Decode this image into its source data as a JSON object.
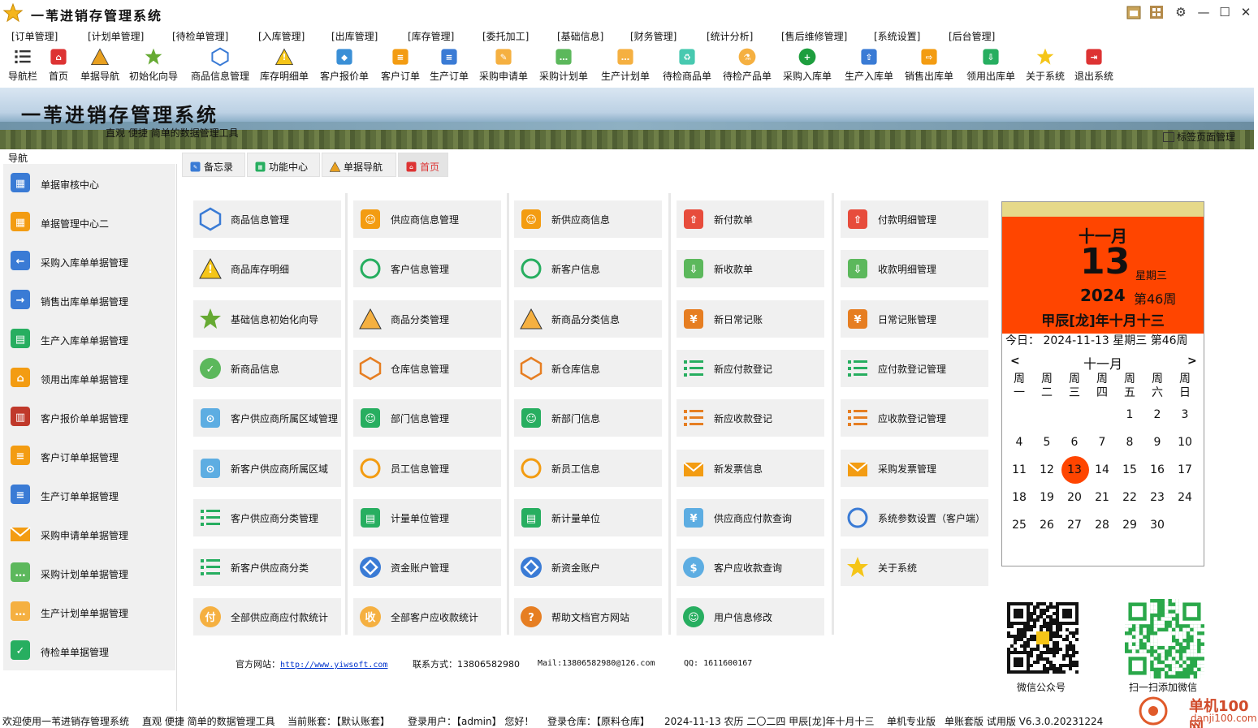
{
  "window": {
    "title": "一苇进销存管理系统"
  },
  "menu": [
    "[订单管理]",
    "[计划单管理]",
    "[待检单管理]",
    "[入库管理]",
    "[出库管理]",
    "[库存管理]",
    "[委托加工]",
    "[基础信息]",
    "[财务管理]",
    "[统计分析]",
    "[售后维修管理]",
    "[系统设置]",
    "[后台管理]"
  ],
  "toolbar": [
    "导航栏",
    "首页",
    "单据导航",
    "初始化向导",
    "商品信息管理",
    "库存明细单",
    "客户报价单",
    "客户订单",
    "生产订单",
    "采购申请单",
    "采购计划单",
    "生产计划单",
    "待检商品单",
    "待检产品单",
    "采购入库单",
    "生产入库单",
    "销售出库单",
    "领用出库单",
    "关于系统",
    "退出系统"
  ],
  "banner": {
    "title": "一苇进销存管理系统",
    "subtitle": "直观 便捷 简单的数据管理工具",
    "tag_manage": "标签页面管理"
  },
  "nav": {
    "label": "导航",
    "items": [
      "单据审核中心",
      "单据管理中心二",
      "采购入库单单据管理",
      "销售出库单单据管理",
      "生产入库单单据管理",
      "领用出库单单据管理",
      "客户报价单单据管理",
      "客户订单单据管理",
      "生产订单单据管理",
      "采购申请单单据管理",
      "采购计划单单据管理",
      "生产计划单单据管理",
      "待检单单据管理"
    ]
  },
  "tabs": [
    "备忘录",
    "功能中心",
    "单据导航",
    "首页"
  ],
  "grid": {
    "col1": [
      "商品信息管理",
      "商品库存明细",
      "基础信息初始化向导",
      "新商品信息",
      "客户供应商所属区域管理",
      "新客户供应商所属区域",
      "客户供应商分类管理",
      "新客户供应商分类",
      "全部供应商应付款统计"
    ],
    "col2": [
      "供应商信息管理",
      "客户信息管理",
      "商品分类管理",
      "仓库信息管理",
      "部门信息管理",
      "员工信息管理",
      "计量单位管理",
      "资金账户管理",
      "全部客户应收款统计"
    ],
    "col3": [
      "新供应商信息",
      "新客户信息",
      "新商品分类信息",
      "新仓库信息",
      "新部门信息",
      "新员工信息",
      "新计量单位",
      "新资金账户",
      "帮助文档官方网站"
    ],
    "col4": [
      "新付款单",
      "新收款单",
      "新日常记账",
      "新应付款登记",
      "新应收款登记",
      "新发票信息",
      "供应商应付款查询",
      "客户应收款查询",
      "用户信息修改"
    ],
    "col5": [
      "付款明细管理",
      "收款明细管理",
      "日常记账管理",
      "应付款登记管理",
      "应收款登记管理",
      "采购发票管理",
      "系统参数设置（客户端）",
      "关于系统"
    ]
  },
  "calendar": {
    "month_cn": "十一月",
    "day": "13",
    "weekday": "星期三",
    "year": "2024",
    "week": "第46周",
    "lunar": "甲辰[龙]年十月十三",
    "today": "今日：   2024-11-13 星期三 第46周",
    "nav_month": "十一月",
    "prev": "<",
    "next": ">",
    "weekdays": [
      "周\n一",
      "周\n二",
      "周\n三",
      "周\n四",
      "周\n五",
      "周\n六",
      "周\n日"
    ],
    "days": [
      "1",
      "2",
      "3",
      "4",
      "5",
      "6",
      "7",
      "8",
      "9",
      "10",
      "11",
      "12",
      "13",
      "14",
      "15",
      "16",
      "17",
      "18",
      "19",
      "20",
      "21",
      "22",
      "23",
      "24",
      "25",
      "26",
      "27",
      "28",
      "29",
      "30"
    ],
    "selected": "13",
    "accent": "#ff4500"
  },
  "footer": {
    "site_label": "官方网站：",
    "site_url": "http://www.yiwsoft.com",
    "contact": "联系方式：13806582980",
    "mail": "Mail:13806582980@126.com",
    "qq": "QQ: 1611600167",
    "qr1_label": "微信公众号",
    "qr2_label": "扫一扫添加微信"
  },
  "status": {
    "welcome": "欢迎使用一苇进销存管理系统",
    "subtitle": "直观 便捷 简单的数据管理工具",
    "account": "当前账套：【默认账套】",
    "user": "登录用户：【admin】 您好！",
    "warehouse": "登录仓库：【原料仓库】",
    "date": "2024-11-13  农历 二〇二四 甲辰[龙]年十月十三",
    "edition": "单机专业版",
    "version": "单账套版 试用版  V6.3.0.20231224"
  },
  "watermark": {
    "text": "单机100网",
    "url": "danji100.com"
  }
}
